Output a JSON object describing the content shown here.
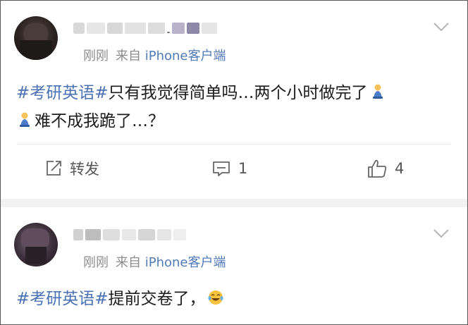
{
  "posts": [
    {
      "meta": {
        "time": "刚刚",
        "via": "来自",
        "source": "iPhone客户端"
      },
      "content": {
        "topic": "#考研英语#",
        "line1_text": "只有我觉得简单吗…两个小时做完了",
        "line2_text": "难不成我跪了…？"
      },
      "actions": {
        "repost_label": "转发",
        "comment_count": "1",
        "like_count": "4"
      }
    },
    {
      "meta": {
        "time": "刚刚",
        "via": "来自",
        "source": "iPhone客户端"
      },
      "content": {
        "topic": "#考研英语#",
        "text": "提前交卷了，"
      }
    }
  ],
  "icons": {
    "kneel_emoji": "kneeling-person-emoji",
    "laugh_emoji": "tears-of-joy-emoji",
    "more_menu": "chevron-down-icon",
    "repost": "repost-icon",
    "comment": "comment-icon",
    "like": "thumbs-up-icon"
  },
  "colors": {
    "topic": "#4b72b4",
    "source": "#527ab8",
    "meta": "#8c8c8c",
    "separator": "#f2f2f2"
  }
}
